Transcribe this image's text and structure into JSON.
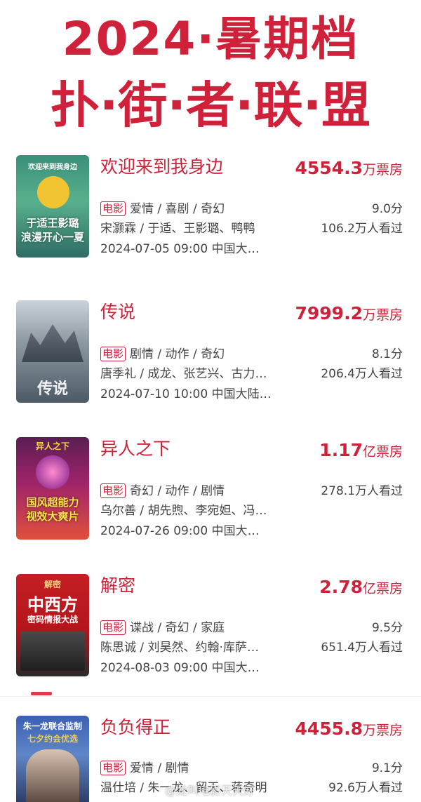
{
  "header": {
    "line1": "2024·暑期档",
    "line2": "扑·街·者·联·盟"
  },
  "colors": {
    "accent": "#d0213a"
  },
  "movies": [
    {
      "title": "欢迎来到我身边",
      "box_value": "4554.3",
      "box_unit": "万票房",
      "tag": "电影",
      "genres": "爱情 / 喜剧 / 奇幻",
      "score": "9.0分",
      "cast": "宋灏霖 / 于适、王影璐、鸭鸭",
      "viewers": "106.2万人看过",
      "release": "2024-07-05 09:00 中国大…",
      "poster_lines": [
        "欢迎来到我身边",
        "于适王影璐",
        "浪漫开心一夏"
      ]
    },
    {
      "title": "传说",
      "box_value": "7999.2",
      "box_unit": "万票房",
      "tag": "电影",
      "genres": "剧情 / 动作 / 奇幻",
      "score": "8.1分",
      "cast": "唐季礼 / 成龙、张艺兴、古力…",
      "viewers": "206.4万人看过",
      "release": "2024-07-10 10:00 中国大陆…",
      "poster_lines": [
        "传说"
      ]
    },
    {
      "title": "异人之下",
      "box_value": "1.17",
      "box_unit": "亿票房",
      "tag": "电影",
      "genres": "奇幻 / 动作 / 剧情",
      "score": "",
      "cast": "乌尔善 / 胡先煦、李宛妲、冯…",
      "viewers": "278.1万人看过",
      "release": "2024-07-26 09:00 中国大…",
      "poster_lines": [
        "异人之下",
        "国风超能力",
        "视效大爽片"
      ]
    },
    {
      "title": "解密",
      "box_value": "2.78",
      "box_unit": "亿票房",
      "tag": "电影",
      "genres": "谍战 / 奇幻 / 家庭",
      "score": "9.5分",
      "cast": "陈思诚 / 刘昊然、约翰·库萨…",
      "viewers": "651.4万人看过",
      "release": "2024-08-03 09:00 中国大…",
      "poster_lines": [
        "解密",
        "中西方",
        "密码情报大战"
      ]
    },
    {
      "title": "负负得正",
      "box_value": "4455.8",
      "box_unit": "万票房",
      "tag": "电影",
      "genres": "爱情 / 剧情",
      "score": "9.1分",
      "cast": "温仕培 / 朱一龙、留天、蒋奇明",
      "viewers": "92.6万人看过",
      "release": "",
      "poster_lines": [
        "朱一龙联合监制",
        "七夕约会优选"
      ]
    }
  ],
  "watermark": "@龙叫电影天天好"
}
